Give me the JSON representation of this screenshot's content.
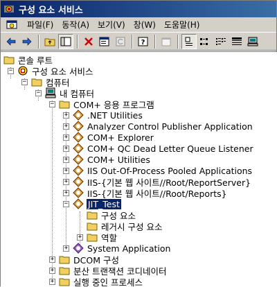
{
  "window": {
    "title": "구성 요소 서비스"
  },
  "menu": [
    "파일(F)",
    "동작(A)",
    "보기(V)",
    "창(W)",
    "도움말(H)"
  ],
  "toolbar": {
    "buttons": [
      "back-icon",
      "forward-icon",
      "up-icon",
      "show-hide-tree-icon",
      "delete-icon",
      "properties-icon",
      "refresh-icon",
      "help-icon",
      "new-icon",
      "large-icons-icon",
      "small-icons-icon",
      "list-icon",
      "details-icon",
      "computer-icon"
    ]
  },
  "tree": {
    "root": "콘솔 루트",
    "component_services": "구성 요소 서비스",
    "computers": "컴퓨터",
    "my_computer": "내 컴퓨터",
    "com_apps": "COM+ 응용 프로그램",
    "apps": [
      ".NET Utilities",
      "Analyzer Control Publisher Application",
      "COM+ Explorer",
      "COM+ QC Dead Letter Queue Listener",
      "COM+ Utilities",
      "IIS Out-Of-Process Pooled Applications",
      "IIS-{기본 웹 사이트//Root/ReportServer}",
      "IIS-{기본 웹 사이트//Root/Reports}"
    ],
    "jit_test": "JIT_Test",
    "jit_children": [
      "구성 요소",
      "레거시 구성 요소",
      "역할"
    ],
    "system_app": "System Application",
    "after": [
      "DCOM 구성",
      "분산 트랜잭션 코디네이터",
      "실행 중인 프로세스"
    ]
  }
}
